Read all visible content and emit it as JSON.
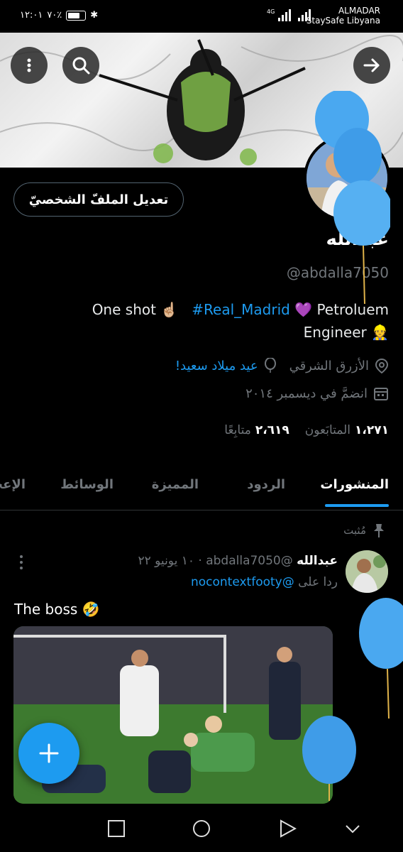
{
  "status_bar": {
    "time": "١٢:٠١",
    "battery": "٧٠٪",
    "carrier_name": "ALMADAR",
    "carrier_sub": "StaySafe Libyana",
    "network": "4G"
  },
  "header": {
    "menu_icon": "more-vertical-icon",
    "search_icon": "search-icon",
    "forward_icon": "arrow-right-icon"
  },
  "profile": {
    "edit_button": "تعديل الملفّ الشخصيّ",
    "display_name": "عبدالله",
    "handle": "@abdalla7050",
    "bio_part1": "One shot ☝🏼",
    "bio_hashtag": "#Real_Madrid",
    "bio_part2": "💜 Petroluem",
    "bio_line2": "Engineer 👷",
    "location": "الأزرق الشرقي",
    "birthday_link": "عيد ميلاد سعيد!",
    "joined": "انضمَّ في ديسمبر ٢٠١٤",
    "followers_count": "١،٢٧١",
    "followers_label": "المتابَعون",
    "following_count": "٢،٦١٩",
    "following_label": "متابِعًا"
  },
  "tabs": [
    {
      "label": "المنشورات",
      "active": true
    },
    {
      "label": "الردود",
      "active": false
    },
    {
      "label": "المميزة",
      "active": false
    },
    {
      "label": "الوسائط",
      "active": false
    },
    {
      "label": "الإعجا",
      "active": false
    }
  ],
  "post": {
    "pinned_label": "مُثبت",
    "author_name": "عبدالله",
    "author_handle": "@abdalla7050",
    "date": "١٠ يونيو ٢٢",
    "reply_prefix": "ردا على",
    "reply_to": "@nocontextfooty",
    "text": "The boss 🤣"
  },
  "fab": {
    "icon": "plus-icon"
  },
  "colors": {
    "accent": "#1d9bf0",
    "background": "#000000",
    "secondary_text": "#71767b"
  }
}
